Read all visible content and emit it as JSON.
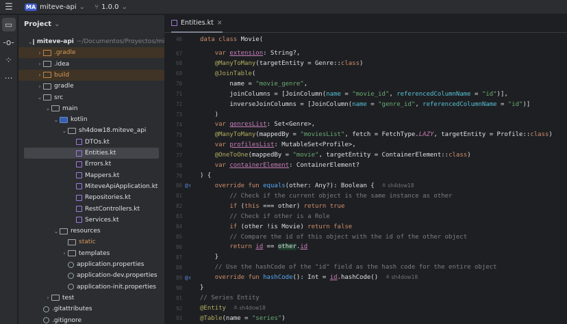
{
  "topbar": {
    "project_badge": "MA",
    "project_name": "miteve-api",
    "branch": "1.0.0"
  },
  "project_panel": {
    "title": "Project",
    "items": [
      {
        "label": "miteve-api",
        "note": "~/Documentos/Proyectos/miteve-api",
        "depth": 0,
        "open": true,
        "icon": "module",
        "style": ""
      },
      {
        "label": ".gradle",
        "depth": 1,
        "open": false,
        "icon": "folder-orange",
        "style": "hl"
      },
      {
        "label": ".idea",
        "depth": 1,
        "open": false,
        "icon": "folder",
        "style": ""
      },
      {
        "label": "build",
        "depth": 1,
        "open": false,
        "icon": "folder-orange",
        "style": "hl"
      },
      {
        "label": "gradle",
        "depth": 1,
        "open": false,
        "icon": "folder",
        "style": ""
      },
      {
        "label": "src",
        "depth": 1,
        "open": true,
        "icon": "folder",
        "style": ""
      },
      {
        "label": "main",
        "depth": 2,
        "open": true,
        "icon": "module",
        "style": ""
      },
      {
        "label": "kotlin",
        "depth": 3,
        "open": true,
        "icon": "folder-blue",
        "style": ""
      },
      {
        "label": "sh4dow18.miteve_api",
        "depth": 4,
        "open": true,
        "icon": "folder",
        "style": ""
      },
      {
        "label": "DTOs.kt",
        "depth": 5,
        "icon": "kt",
        "style": ""
      },
      {
        "label": "Entities.kt",
        "depth": 5,
        "icon": "kt",
        "style": "sel"
      },
      {
        "label": "Errors.kt",
        "depth": 5,
        "icon": "kt",
        "style": ""
      },
      {
        "label": "Mappers.kt",
        "depth": 5,
        "icon": "kt",
        "style": ""
      },
      {
        "label": "MiteveApiApplication.kt",
        "depth": 5,
        "icon": "kt",
        "style": ""
      },
      {
        "label": "Repositories.kt",
        "depth": 5,
        "icon": "kt",
        "style": ""
      },
      {
        "label": "RestControllers.kt",
        "depth": 5,
        "icon": "kt",
        "style": ""
      },
      {
        "label": "Services.kt",
        "depth": 5,
        "icon": "kt",
        "style": ""
      },
      {
        "label": "resources",
        "depth": 3,
        "open": true,
        "icon": "folder",
        "style": ""
      },
      {
        "label": "static",
        "depth": 4,
        "icon": "folder",
        "style": "orange"
      },
      {
        "label": "templates",
        "depth": 4,
        "open": false,
        "icon": "folder",
        "style": ""
      },
      {
        "label": "application.properties",
        "depth": 4,
        "icon": "file",
        "style": ""
      },
      {
        "label": "application-dev.properties",
        "depth": 4,
        "icon": "file",
        "style": ""
      },
      {
        "label": "application-init.properties",
        "depth": 4,
        "icon": "file",
        "style": ""
      },
      {
        "label": "test",
        "depth": 2,
        "open": false,
        "icon": "folder",
        "style": ""
      },
      {
        "label": ".gitattributes",
        "depth": 1,
        "icon": "file",
        "style": ""
      },
      {
        "label": ".gitignore",
        "depth": 1,
        "icon": "file",
        "style": ""
      }
    ]
  },
  "editor": {
    "tab": "Entities.kt",
    "lines": [
      {
        "n": "46",
        "t": [
          [
            "kw",
            "data class "
          ],
          [
            "pl",
            "Movie("
          ]
        ]
      },
      {
        "n": "67",
        "t": [
          [
            "pl",
            "    "
          ],
          [
            "kw",
            "var "
          ],
          [
            "pr",
            "extension"
          ],
          [
            "pl",
            ": String?,"
          ]
        ]
      },
      {
        "n": "68",
        "t": [
          [
            "pl",
            "    "
          ],
          [
            "an",
            "@ManyToMany"
          ],
          [
            "pl",
            "(targetEntity = Genre::"
          ],
          [
            "kw",
            "class"
          ],
          [
            "pl",
            ")"
          ]
        ]
      },
      {
        "n": "69",
        "t": [
          [
            "pl",
            "    "
          ],
          [
            "an",
            "@JoinTable"
          ],
          [
            "pl",
            "("
          ]
        ]
      },
      {
        "n": "70",
        "t": [
          [
            "pl",
            "        name = "
          ],
          [
            "st",
            "\"movie_genre\""
          ],
          [
            "pl",
            ","
          ]
        ]
      },
      {
        "n": "71",
        "t": [
          [
            "pl",
            "        joinColumns = [JoinColumn("
          ],
          [
            "pa",
            "name"
          ],
          [
            "pl",
            " = "
          ],
          [
            "st",
            "\"movie_id\""
          ],
          [
            "pl",
            ", "
          ],
          [
            "pa",
            "referencedColumnName"
          ],
          [
            "pl",
            " = "
          ],
          [
            "st",
            "\"id\""
          ],
          [
            "pl",
            ")],"
          ]
        ]
      },
      {
        "n": "72",
        "t": [
          [
            "pl",
            "        inverseJoinColumns = [JoinColumn("
          ],
          [
            "pa",
            "name"
          ],
          [
            "pl",
            " = "
          ],
          [
            "st",
            "\"genre_id\""
          ],
          [
            "pl",
            ", "
          ],
          [
            "pa",
            "referencedColumnName"
          ],
          [
            "pl",
            " = "
          ],
          [
            "st",
            "\"id\""
          ],
          [
            "pl",
            ")]"
          ]
        ]
      },
      {
        "n": "73",
        "t": [
          [
            "pl",
            "    )"
          ]
        ]
      },
      {
        "n": "74",
        "t": [
          [
            "pl",
            "    "
          ],
          [
            "kw",
            "var "
          ],
          [
            "pr",
            "genresList"
          ],
          [
            "pl",
            ": Set<Genre>,"
          ]
        ]
      },
      {
        "n": "75",
        "t": [
          [
            "pl",
            "    "
          ],
          [
            "an",
            "@ManyToMany"
          ],
          [
            "pl",
            "(mappedBy = "
          ],
          [
            "st",
            "\"moviesList\""
          ],
          [
            "pl",
            ", fetch = FetchType."
          ],
          [
            "cst",
            "LAZY"
          ],
          [
            "pl",
            ", targetEntity = Profile::"
          ],
          [
            "kw",
            "class"
          ],
          [
            "pl",
            ")"
          ]
        ]
      },
      {
        "n": "76",
        "t": [
          [
            "pl",
            "    "
          ],
          [
            "kw",
            "var "
          ],
          [
            "pr",
            "profilesList"
          ],
          [
            "pl",
            ": MutableSet<Profile>,"
          ]
        ]
      },
      {
        "n": "77",
        "t": [
          [
            "pl",
            "    "
          ],
          [
            "an",
            "@OneToOne"
          ],
          [
            "pl",
            "(mappedBy = "
          ],
          [
            "st",
            "\"movie\""
          ],
          [
            "pl",
            ", targetEntity = ContainerElement::"
          ],
          [
            "kw",
            "class"
          ],
          [
            "pl",
            ")"
          ]
        ]
      },
      {
        "n": "78",
        "t": [
          [
            "pl",
            "    "
          ],
          [
            "kw",
            "var "
          ],
          [
            "pr",
            "containerElement"
          ],
          [
            "pl",
            ": ContainerElement?"
          ]
        ]
      },
      {
        "n": "79",
        "t": [
          [
            "pl",
            ") {"
          ]
        ]
      },
      {
        "n": "80",
        "g": "@↑",
        "t": [
          [
            "pl",
            "    "
          ],
          [
            "kw",
            "override fun "
          ],
          [
            "fn",
            "equals"
          ],
          [
            "pl",
            "(other: Any?): Boolean {  "
          ],
          [
            "au",
            "≛ sh4dow18"
          ]
        ]
      },
      {
        "n": "81",
        "t": [
          [
            "cm",
            "        // Check if the current object is the same instance as other"
          ]
        ]
      },
      {
        "n": "82",
        "t": [
          [
            "pl",
            "        "
          ],
          [
            "kw",
            "if "
          ],
          [
            "pl",
            "("
          ],
          [
            "kw",
            "this"
          ],
          [
            "pl",
            " === other) "
          ],
          [
            "kw",
            "return true"
          ]
        ]
      },
      {
        "n": "83",
        "t": [
          [
            "cm",
            "        // Check if other is a Role"
          ]
        ]
      },
      {
        "n": "84",
        "t": [
          [
            "pl",
            "        "
          ],
          [
            "kw",
            "if "
          ],
          [
            "pl",
            "(other !is Movie) "
          ],
          [
            "kw",
            "return false"
          ]
        ]
      },
      {
        "n": "85",
        "t": [
          [
            "cm",
            "        // Compare the id of this object with the id of the other object"
          ]
        ]
      },
      {
        "n": "86",
        "t": [
          [
            "pl",
            "        "
          ],
          [
            "kw",
            "return "
          ],
          [
            "pr",
            "id"
          ],
          [
            "pl",
            " == "
          ],
          [
            "hlv",
            "other"
          ],
          [
            "pl",
            "."
          ],
          [
            "pr",
            "id"
          ]
        ]
      },
      {
        "n": "87",
        "t": [
          [
            "pl",
            "    }"
          ]
        ]
      },
      {
        "n": "88",
        "t": [
          [
            "cm",
            "    // Use the hashCode of the \"id\" field as the hash code for the entire object"
          ]
        ]
      },
      {
        "n": "89",
        "g": "@↑",
        "t": [
          [
            "pl",
            "    "
          ],
          [
            "kw",
            "override fun "
          ],
          [
            "fn",
            "hashCode"
          ],
          [
            "pl",
            "(): Int = "
          ],
          [
            "pr",
            "id"
          ],
          [
            "pl",
            ".hashCode()  "
          ],
          [
            "au",
            "≛ sh4dow18"
          ]
        ]
      },
      {
        "n": "90",
        "t": [
          [
            "pl",
            "}"
          ]
        ]
      },
      {
        "n": "91",
        "t": [
          [
            "cm",
            "// Series Entity"
          ]
        ]
      },
      {
        "n": "92",
        "t": [
          [
            "an",
            "@Entity"
          ],
          [
            "pl",
            "  "
          ],
          [
            "au",
            "≛ sh4dow18"
          ]
        ]
      },
      {
        "n": "93",
        "t": [
          [
            "an",
            "@Table"
          ],
          [
            "pl",
            "(name = "
          ],
          [
            "st",
            "\"series\""
          ],
          [
            "pl",
            ")"
          ]
        ]
      }
    ]
  }
}
